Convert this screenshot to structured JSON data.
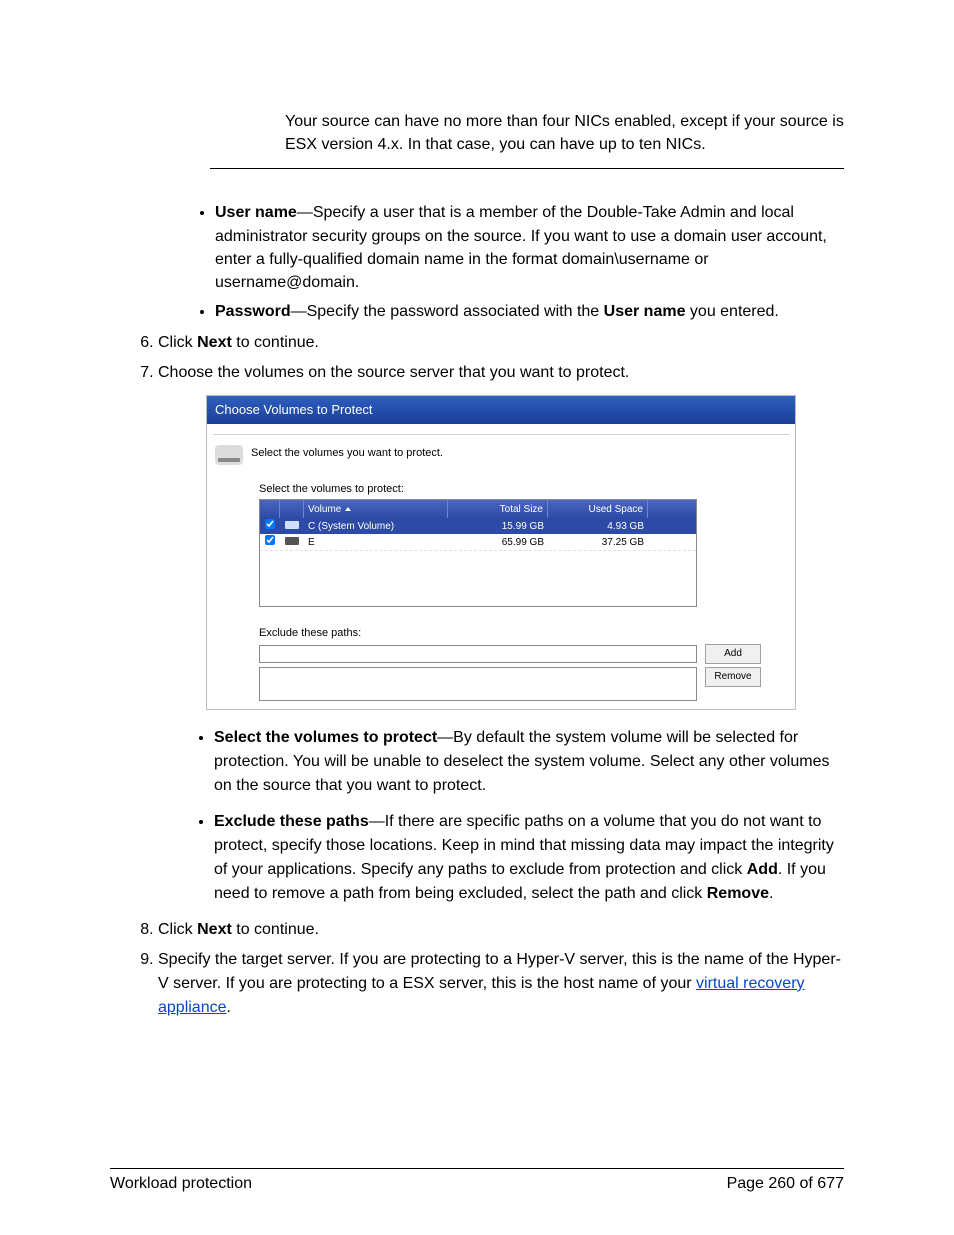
{
  "intro": "Your source can have no more than four NICs enabled, except if your source is ESX version 4.x. In that case, you can have up to ten NICs.",
  "bullets_top": {
    "user_name_label": "User name",
    "user_name_text": "—Specify a user that is a member of the Double-Take Admin and local administrator security groups on the source. If you want to use a domain user account, enter a fully-qualified domain name in the format domain\\username or username@domain.",
    "password_label": "Password",
    "password_text_1": "—Specify the password associated with the ",
    "password_text_bold": "User name",
    "password_text_2": " you entered."
  },
  "steps": {
    "s6_a": "Click ",
    "s6_bold": "Next",
    "s6_b": " to continue.",
    "s7": "Choose the volumes on the source server that you want to protect.",
    "s8_a": "Click ",
    "s8_bold": "Next",
    "s8_b": " to continue.",
    "s9_a": "Specify the target server. If you are protecting to a Hyper-V server, this is the name of the Hyper-V server. If you are protecting to a ESX server, this is the host name of your ",
    "s9_link": "virtual recovery appliance",
    "s9_b": "."
  },
  "dialog": {
    "title": "Choose Volumes to Protect",
    "desc": "Select the volumes you want to protect.",
    "select_label": "Select the volumes to protect:",
    "headers": {
      "volume": "Volume",
      "total_size": "Total Size",
      "used_space": "Used Space"
    },
    "rows": [
      {
        "checked": true,
        "selected": true,
        "name": "C (System Volume)",
        "total": "15.99 GB",
        "used": "4.93 GB"
      },
      {
        "checked": true,
        "selected": false,
        "name": "E",
        "total": "65.99 GB",
        "used": "37.25 GB"
      }
    ],
    "exclude_label": "Exclude these paths:",
    "add_btn": "Add",
    "remove_btn": "Remove"
  },
  "bullets_mid": {
    "b1_label": "Select the volumes to protect",
    "b1_text": "—By default the system volume will be selected for protection. You will be unable to deselect the system volume. Select any other volumes on the source that you want to protect.",
    "b2_label": "Exclude these paths",
    "b2_text_1": "—If there are specific paths on a volume that you do not want to protect, specify those locations. Keep in mind that missing data may impact the integrity of your applications. Specify any paths to exclude from protection and click ",
    "b2_bold_add": "Add",
    "b2_text_2": ". If you need to remove a path from being excluded, select the path and click ",
    "b2_bold_remove": "Remove",
    "b2_text_3": "."
  },
  "footer": {
    "left": "Workload protection",
    "right": "Page 260 of 677"
  }
}
